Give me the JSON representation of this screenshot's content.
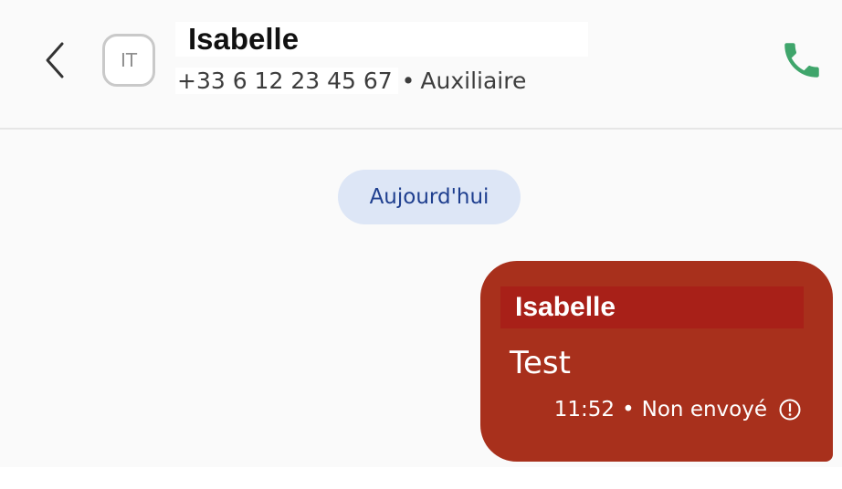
{
  "header": {
    "avatar_initials": "IT",
    "contact_name": "Isabelle",
    "phone_number": "+33 6 12 23 45 67",
    "separator": "•",
    "role": "Auxiliaire",
    "back_icon": "chevron-left-icon",
    "call_icon": "phone-icon",
    "call_color": "#3fa56b"
  },
  "chat": {
    "date_label": "Aujourd'hui",
    "messages": [
      {
        "sender": "Isabelle",
        "text": "Test",
        "time": "11:52",
        "separator": "•",
        "status": "Non envoyé",
        "status_icon": "alert-circle-icon",
        "bubble_color": "#a8301c"
      }
    ]
  }
}
